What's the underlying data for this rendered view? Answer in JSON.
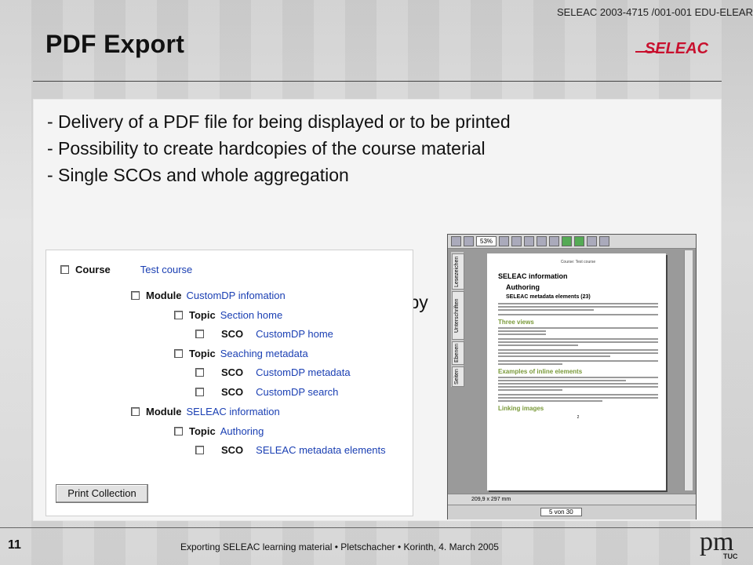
{
  "header": {
    "reference": "SELEAC 2003-4715 /001-001 EDU-ELEAR",
    "title": "PDF Export",
    "logo_text": "SELEAC"
  },
  "bullets": [
    "- Delivery of a PDF file for being displayed or to be printed",
    "- Possibility to create hardcopies of the course material",
    "- Single SCOs and whole aggregation",
    "l by"
  ],
  "course_tree": {
    "rows": [
      {
        "kind": "Course",
        "name": "Test course"
      },
      {
        "kind": "Module",
        "name": "CustomDP infomation"
      },
      {
        "kind": "Topic",
        "name": "Section home"
      },
      {
        "kind": "SCO",
        "name": "CustomDP home"
      },
      {
        "kind": "Topic",
        "name": "Seaching metadata"
      },
      {
        "kind": "SCO",
        "name": "CustomDP metadata"
      },
      {
        "kind": "SCO",
        "name": "CustomDP search"
      },
      {
        "kind": "Module",
        "name": "SELEAC information"
      },
      {
        "kind": "Topic",
        "name": "Authoring"
      },
      {
        "kind": "SCO",
        "name": "SELEAC metadata elements"
      }
    ],
    "print_button": "Print Collection"
  },
  "pdf_viewer": {
    "zoom": "53%",
    "side_tabs": [
      "Lesezeichen",
      "Unterschriften",
      "Ebenen",
      "Seiten"
    ],
    "page": {
      "running_head": "Course: Test course",
      "heading1": "SELEAC information",
      "heading2": "Authoring",
      "heading3": "SELEAC metadata elements (23)",
      "section1": "Three views",
      "section2": "Examples of inline elements",
      "section3": "Linking images",
      "page_number": "2"
    },
    "page_size": "209,9 x 297 mm",
    "page_counter": "5 von 30"
  },
  "footer": {
    "page_number": "11",
    "text": "Exporting SELEAC learning material • Pletschacher • Korinth, 4. March 2005",
    "logo_text": "pm",
    "logo_sub": "TUC"
  },
  "colors": {
    "link_blue": "#1a3fb3",
    "logo_red": "#c8102e"
  }
}
